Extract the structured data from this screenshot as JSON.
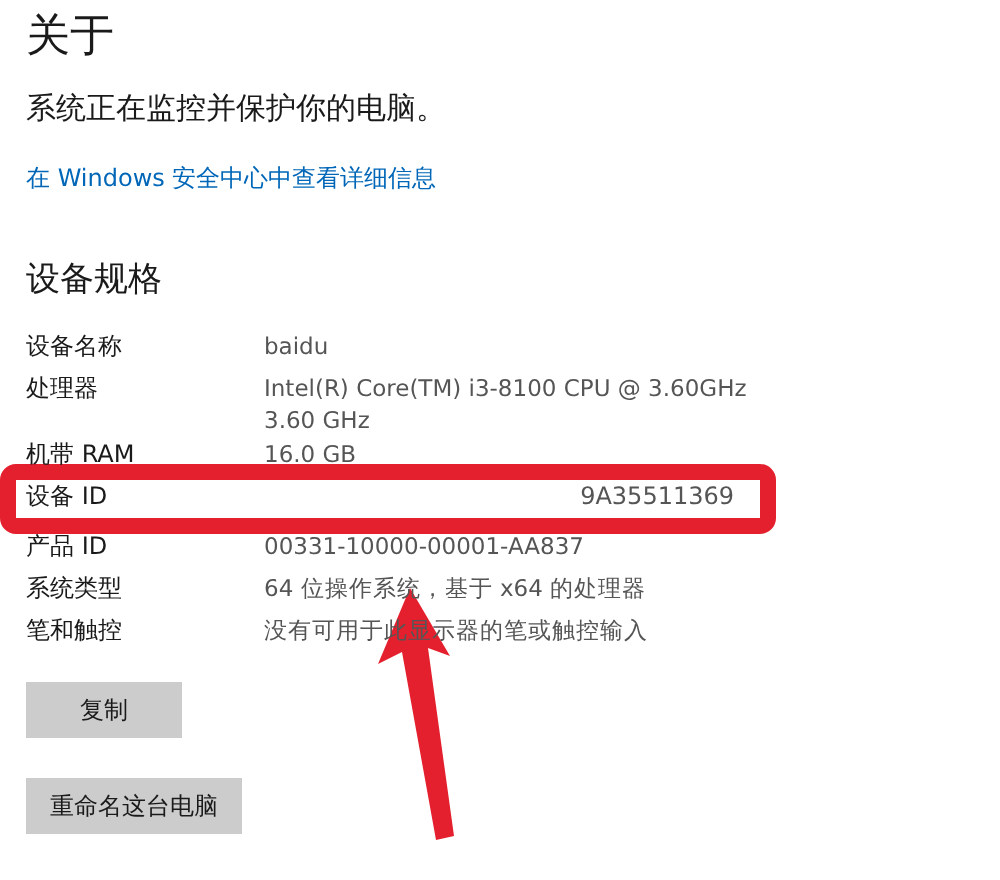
{
  "title": "关于",
  "protection": "系统正在监控并保护你的电脑。",
  "security_link": "在 Windows 安全中心中查看详细信息",
  "specs_heading": "设备规格",
  "specs": [
    {
      "label": "设备名称",
      "value": "baidu",
      "highlighted": false
    },
    {
      "label": "处理器",
      "value": "Intel(R) Core(TM) i3-8100 CPU @ 3.60GHz   3.60 GHz",
      "highlighted": false
    },
    {
      "label": "机带 RAM",
      "value": "16.0 GB",
      "highlighted": false
    },
    {
      "label": "设备 ID",
      "value": "9A35511369",
      "highlighted": true
    },
    {
      "label": "产品 ID",
      "value": "00331-10000-00001-AA837",
      "highlighted": false
    },
    {
      "label": "系统类型",
      "value": "64 位操作系统，基于 x64 的处理器",
      "highlighted": false
    },
    {
      "label": "笔和触控",
      "value": "没有可用于此显示器的笔或触控输入",
      "highlighted": false
    }
  ],
  "buttons": [
    "复制",
    "重命名这台电脑"
  ]
}
